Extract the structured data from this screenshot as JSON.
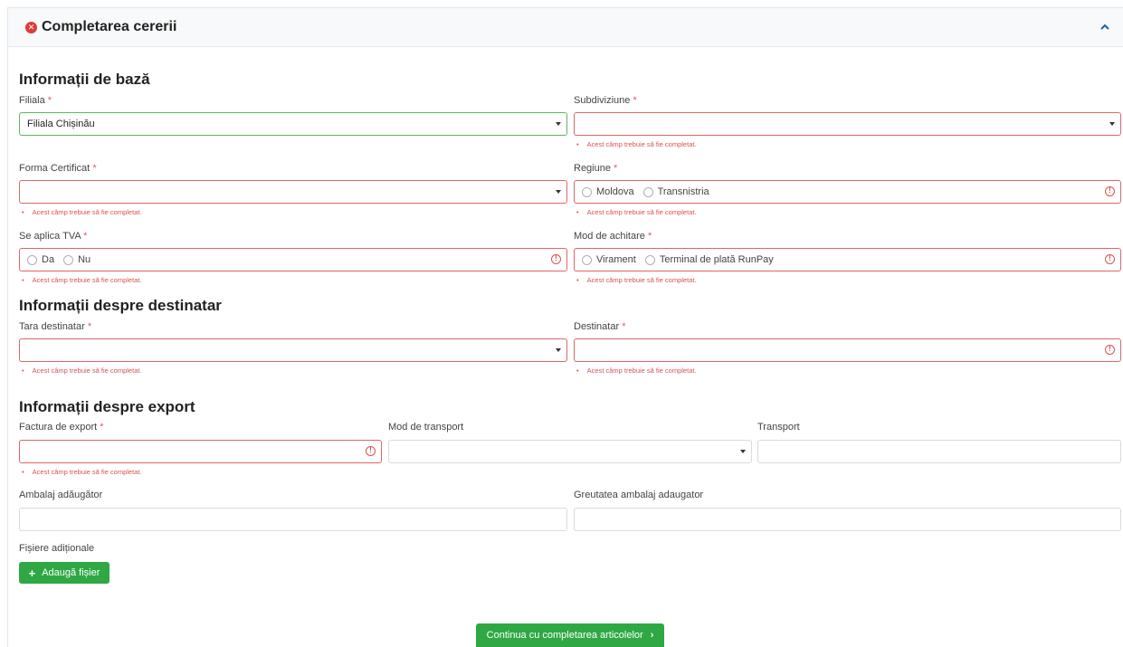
{
  "header": {
    "title": "Completarea cererii"
  },
  "sections": {
    "basic": "Informații de bază",
    "recipient": "Informații despre destinatar",
    "export": "Informații despre export"
  },
  "required_mark": "*",
  "error_text": "Acest câmp trebuie să fie completat.",
  "fields": {
    "filiala": {
      "label": "Filiala",
      "value": "Filiala Chișinău"
    },
    "subdiviziune": {
      "label": "Subdiviziune",
      "value": ""
    },
    "forma_certificat": {
      "label": "Forma Certificat",
      "value": ""
    },
    "regiune": {
      "label": "Regiune",
      "options": [
        "Moldova",
        "Transnistria"
      ]
    },
    "tva": {
      "label": "Se aplica TVA",
      "options": [
        "Da",
        "Nu"
      ]
    },
    "mod_achitare": {
      "label": "Mod de achitare",
      "options": [
        "Virament",
        "Terminal de plată RunPay"
      ]
    },
    "tara_destinatar": {
      "label": "Tara destinatar",
      "value": ""
    },
    "destinatar": {
      "label": "Destinatar",
      "value": ""
    },
    "factura_export": {
      "label": "Factura de export",
      "value": ""
    },
    "mod_transport": {
      "label": "Mod de transport",
      "value": ""
    },
    "transport": {
      "label": "Transport",
      "value": ""
    },
    "ambalaj": {
      "label": "Ambalaj adăugător",
      "value": ""
    },
    "greutate": {
      "label": "Greutatea ambalaj adaugator",
      "value": ""
    },
    "fisiere": {
      "label": "Fișiere adiționale"
    }
  },
  "buttons": {
    "add_file": "Adaugă fișier",
    "continue": "Continua cu completarea articolelor"
  },
  "colors": {
    "accent_green": "#2fa844",
    "error_red": "#d9534f",
    "ok_green": "#5cb85c"
  }
}
